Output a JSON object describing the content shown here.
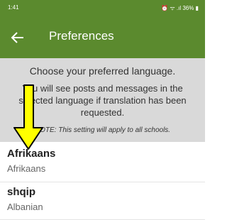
{
  "status_bar": {
    "time": "1:41",
    "right_text": "⏰ ᯤ .ıl 36% ▮"
  },
  "header": {
    "title": "Preferences",
    "back_icon": "arrow-left-icon"
  },
  "info": {
    "heading": "Choose your preferred language.",
    "body": "You will see posts and messages in the selected language if translation has been requested.",
    "note": "NOTE: This setting will apply to all schools."
  },
  "languages": [
    {
      "native": "Afrikaans",
      "english": "Afrikaans"
    },
    {
      "native": "shqip",
      "english": "Albanian"
    }
  ],
  "colors": {
    "brand": "#5b8a2e",
    "panel": "#d9d9d9",
    "annotation": "#ffff00"
  }
}
